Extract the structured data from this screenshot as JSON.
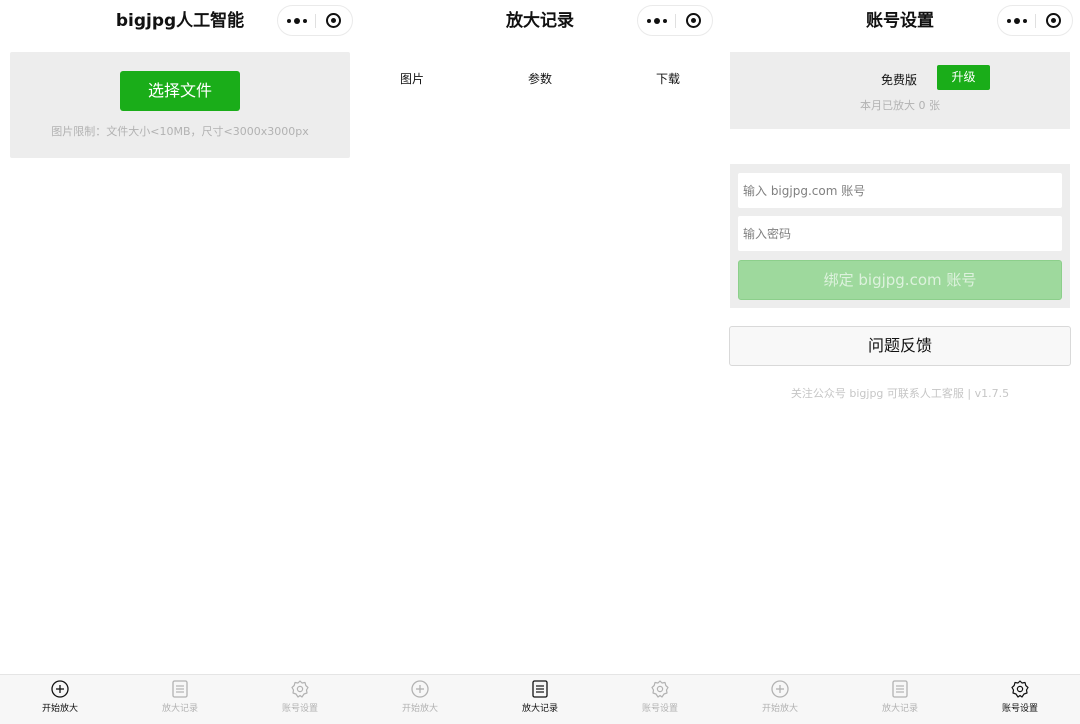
{
  "screens": [
    {
      "nav_title": "bigjpg人工智能",
      "choose_file_label": "选择文件",
      "limit_text": "图片限制：文件大小<10MB，尺寸<3000x3000px",
      "active_tab": 0
    },
    {
      "nav_title": "放大记录",
      "columns": [
        "图片",
        "参数",
        "下载"
      ],
      "active_tab": 1
    },
    {
      "nav_title": "账号设置",
      "plan_name": "免费版",
      "upgrade_label": "升级",
      "usage_text": "本月已放大 0 张",
      "account_placeholder": "输入 bigjpg.com 账号",
      "password_placeholder": "输入密码",
      "bind_label": "绑定 bigjpg.com 账号",
      "feedback_label": "问题反馈",
      "footer_text": "关注公众号 bigjpg 可联系人工客服  |  v1.7.5",
      "active_tab": 2
    }
  ],
  "tabs": [
    {
      "label": "开始放大",
      "icon": "plus-circle-icon"
    },
    {
      "label": "放大记录",
      "icon": "list-icon"
    },
    {
      "label": "账号设置",
      "icon": "gear-icon"
    }
  ],
  "colors": {
    "primary_green": "#1aad19",
    "disabled_green": "#9ed99d",
    "panel_gray": "#ededed",
    "muted_text": "#b2b2b2"
  }
}
